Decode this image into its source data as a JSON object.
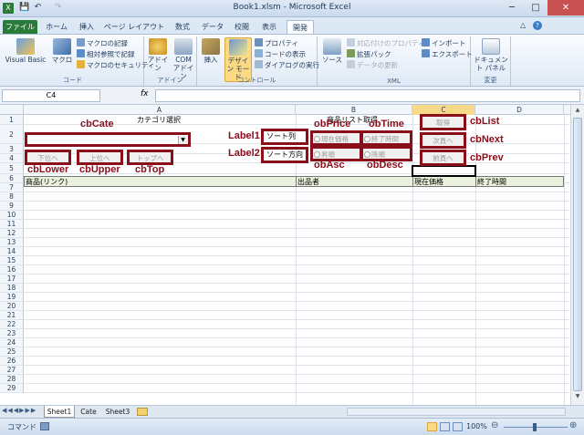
{
  "window": {
    "title": "Book1.xlsm - Microsoft Excel",
    "min": "─",
    "max": "□",
    "close": "✕"
  },
  "quick_access": {
    "save": "💾",
    "undo": "↶",
    "redo": "↷"
  },
  "tabs": [
    "ファイル",
    "ホーム",
    "挿入",
    "ページ レイアウト",
    "数式",
    "データ",
    "校閲",
    "表示",
    "開発"
  ],
  "ribbon": {
    "code": {
      "label": "コード",
      "vb": "Visual Basic",
      "macro": "マクロ",
      "rec": "マクロの記録",
      "rel": "相対参照で記録",
      "sec": "マクロのセキュリティ"
    },
    "addin": {
      "label": "アドイン",
      "addin": "アドイン",
      "com": "COM アドイン"
    },
    "control": {
      "label": "コントロール",
      "insert": "挿入",
      "design": "デザイン モード",
      "prop": "プロパティ",
      "code": "コードの表示",
      "dialog": "ダイアログの実行"
    },
    "xml": {
      "label": "XML",
      "source": "ソース",
      "map": "対応付けのプロパティ",
      "pack": "拡張パック",
      "refresh": "データの更新",
      "import": "インポート",
      "export": "エクスポート"
    },
    "change": {
      "label": "変更",
      "doc": "ドキュメント パネル"
    }
  },
  "formula_bar": {
    "name_box": "C4",
    "fx": "fx",
    "value": ""
  },
  "columns": [
    "A",
    "B",
    "C",
    "D"
  ],
  "rows": [
    "1",
    "2",
    "3",
    "4",
    "5",
    "6",
    "7",
    "8",
    "9",
    "10",
    "11",
    "12",
    "13",
    "14",
    "15",
    "16",
    "17",
    "18",
    "19",
    "20",
    "21",
    "22",
    "23",
    "24",
    "25",
    "26",
    "27",
    "28",
    "29"
  ],
  "cells": {
    "a1": "カテゴリ選択",
    "b1": "商品リスト取得",
    "a5": "商品(リンク)",
    "b5": "出品者",
    "c5": "現在価格",
    "d5": "終了時間"
  },
  "controls": {
    "lower": "下位へ",
    "upper": "上位へ",
    "top": "トップへ",
    "sort_label": "ソート列",
    "sort_dir_label": "ソート方向",
    "price": "現在価格",
    "time": "終了時間",
    "asc": "昇順",
    "desc": "降順",
    "get": "取得",
    "next": "次頁へ",
    "prev": "前頁へ"
  },
  "annotations": {
    "cbCate": "cbCate",
    "cbLower": "cbLower",
    "cbUpper": "cbUpper",
    "cbTop": "cbTop",
    "label1": "Label1",
    "label2": "Label2",
    "obPrice": "obPrice",
    "obTime": "obTime",
    "obAsc": "obAsc",
    "obDesc": "obDesc",
    "cbList": "cbList",
    "cbNext": "cbNext",
    "cbPrev": "cbPrev"
  },
  "sheet_tabs": [
    "Sheet1",
    "Cate",
    "Sheet3"
  ],
  "status": {
    "mode": "コマンド",
    "zoom": "100%"
  },
  "colors": {
    "annotation": "#8b0e1b",
    "header_fill": "#eaf1dd",
    "file_tab": "#2a7a3a"
  }
}
